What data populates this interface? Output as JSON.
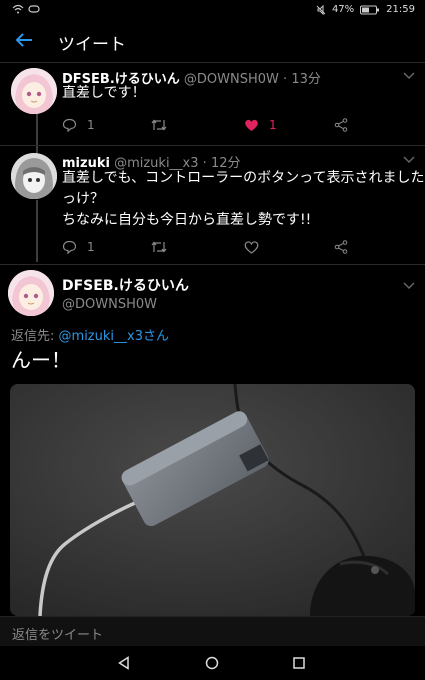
{
  "statusbar": {
    "battery": "47%",
    "time": "21:59"
  },
  "appbar": {
    "title": "ツイート"
  },
  "tweets": [
    {
      "name": "DFSEB.けるひいん",
      "handle": "@DOWNSH0W",
      "time": "13分",
      "text": "直差しです！",
      "reply_count": "1",
      "like_count": "1"
    },
    {
      "name": "mizuki",
      "handle": "@mizuki__x3",
      "time": "12分",
      "text_line1": "直差しでも、コントローラーのボタンって表示されました",
      "text_line2": "っけ？",
      "text_line3": "ちなみに自分も今日から直差し勢です!!",
      "reply_count": "1"
    }
  ],
  "main_tweet": {
    "name": "DFSEB.けるひいん",
    "handle": "@DOWNSH0W",
    "reply_to_label": "返信先:",
    "reply_to_handle": "@mizuki__x3さん",
    "text": "んー！"
  },
  "reply_bar": {
    "placeholder": "返信をツイート"
  },
  "colors": {
    "accent": "#2c97e6",
    "like": "#e0245e",
    "background": "#000000"
  }
}
